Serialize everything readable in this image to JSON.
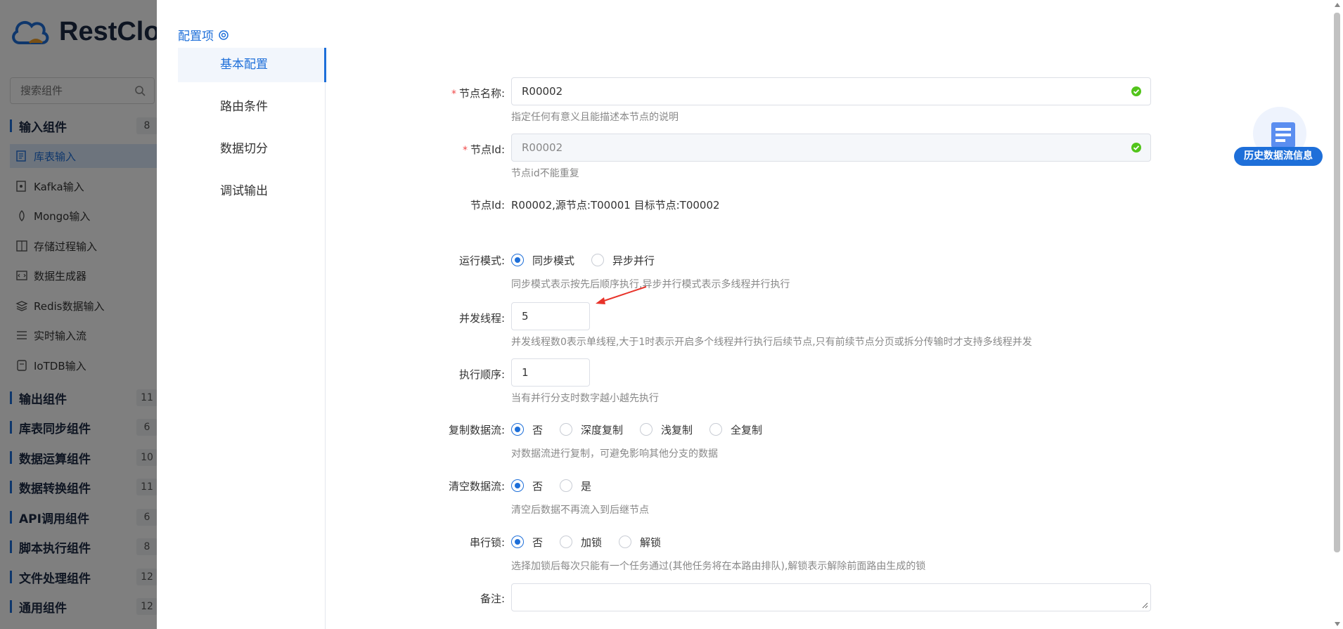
{
  "background_app": {
    "logo_text": "RestClo",
    "search_placeholder": "搜索组件",
    "groups": [
      {
        "name": "输入组件",
        "count": "8"
      },
      {
        "name": "输出组件",
        "count": "11"
      },
      {
        "name": "库表同步组件",
        "count": "6"
      },
      {
        "name": "数据运算组件",
        "count": "10"
      },
      {
        "name": "数据转换组件",
        "count": "11"
      },
      {
        "name": "API调用组件",
        "count": "6"
      },
      {
        "name": "脚本执行组件",
        "count": "8"
      },
      {
        "name": "文件处理组件",
        "count": "12"
      },
      {
        "name": "通用组件",
        "count": "12"
      }
    ],
    "input_components": [
      {
        "label": "库表输入",
        "icon": "table-doc-icon"
      },
      {
        "label": "Kafka输入",
        "icon": "kafka-icon"
      },
      {
        "label": "Mongo输入",
        "icon": "mongo-icon"
      },
      {
        "label": "存储过程输入",
        "icon": "procedure-icon"
      },
      {
        "label": "数据生成器",
        "icon": "generator-icon"
      },
      {
        "label": "Redis数据输入",
        "icon": "redis-icon"
      },
      {
        "label": "实时输入流",
        "icon": "stream-icon"
      },
      {
        "label": "IoTDB输入",
        "icon": "iotdb-icon"
      }
    ]
  },
  "drawer": {
    "title": "配置项",
    "tabs": [
      "基本配置",
      "路由条件",
      "数据切分",
      "调试输出"
    ],
    "active_tab": "基本配置",
    "form": {
      "node_name": {
        "label": "节点名称:",
        "value": "R00002",
        "hint": "指定任何有意义且能描述本节点的说明"
      },
      "node_id": {
        "label": "节点Id:",
        "value": "R00002",
        "hint": "节点id不能重复"
      },
      "node_id_info": {
        "label": "节点Id:",
        "value": "R00002,源节点:T00001 目标节点:T00002"
      },
      "run_mode": {
        "label": "运行模式:",
        "options": [
          "同步模式",
          "异步并行"
        ],
        "selected": "同步模式",
        "hint": "同步模式表示按先后顺序执行,异步并行模式表示多线程并行执行"
      },
      "threads": {
        "label": "并发线程:",
        "value": "5",
        "hint": "并发线程数0表示单线程,大于1时表示开启多个线程并行执行后续节点,只有前续节点分页或拆分传输时才支持多线程并发"
      },
      "exec_order": {
        "label": "执行顺序:",
        "value": "1",
        "hint": "当有并行分支时数字越小越先执行"
      },
      "copy_stream": {
        "label": "复制数据流:",
        "options": [
          "否",
          "深度复制",
          "浅复制",
          "全复制"
        ],
        "selected": "否",
        "hint": "对数据流进行复制，可避免影响其他分支的数据"
      },
      "clear_stream": {
        "label": "清空数据流:",
        "options": [
          "否",
          "是"
        ],
        "selected": "否",
        "hint": "清空后数据不再流入到后继节点"
      },
      "serial_lock": {
        "label": "串行锁:",
        "options": [
          "否",
          "加锁",
          "解锁"
        ],
        "selected": "否",
        "hint": "选择加锁后每次只能有一个任务通过(其他任务将在本路由排队),解锁表示解除前面路由生成的锁"
      },
      "remark": {
        "label": "备注:",
        "value": ""
      }
    }
  },
  "history_button": {
    "label": "历史数据流信息",
    "icon": "history-doc-icon"
  },
  "colors": {
    "accent": "#1e6fd9",
    "required": "#f04848",
    "success": "#52c41a",
    "annotation_arrow": "#e8332a"
  }
}
